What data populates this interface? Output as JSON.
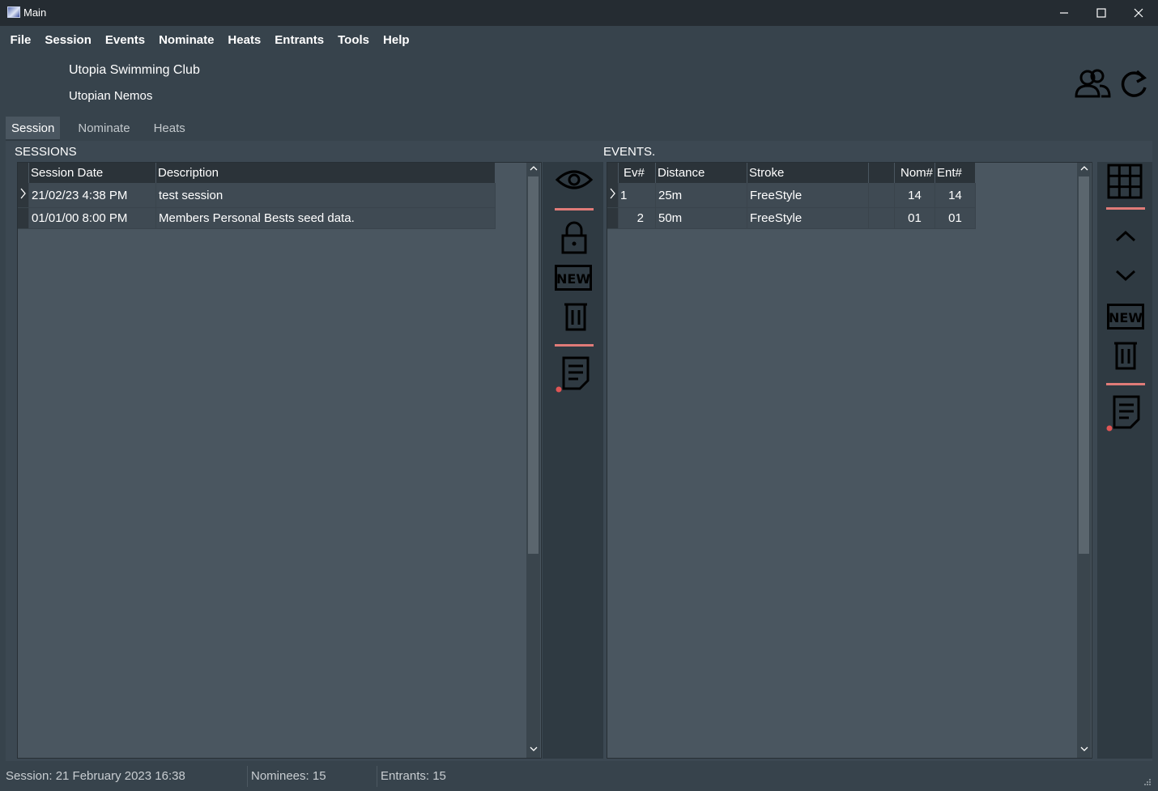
{
  "window": {
    "title": "Main"
  },
  "menu": [
    "File",
    "Session",
    "Events",
    "Nominate",
    "Heats",
    "Entrants",
    "Tools",
    "Help"
  ],
  "header": {
    "club": "Utopia Swimming Club",
    "team": "Utopian Nemos"
  },
  "tabs": [
    "Session",
    "Nominate",
    "Heats"
  ],
  "sessions": {
    "label": "SESSIONS",
    "columns": [
      "Session Date",
      "Description"
    ],
    "rows": [
      {
        "date": "21/02/23 4:38 PM",
        "description": "test session"
      },
      {
        "date": "01/01/00 8:00 PM",
        "description": "Members Personal Bests seed data."
      }
    ]
  },
  "events": {
    "label": "EVENTS.",
    "columns": [
      "Ev#",
      "Distance",
      "Stroke",
      "",
      "Nom#",
      "Ent#"
    ],
    "rows": [
      {
        "ev": "1",
        "distance": "25m",
        "stroke": "FreeStyle",
        "blank": "",
        "nom": "14",
        "ent": "14"
      },
      {
        "ev": "2",
        "distance": "50m",
        "stroke": "FreeStyle",
        "blank": "",
        "nom": "01",
        "ent": "01"
      }
    ]
  },
  "icons": {
    "middle_toolbar": [
      "eye-icon",
      "lock-icon",
      "new-icon",
      "trash-icon",
      "report-icon"
    ],
    "right_toolbar": [
      "grid-icon",
      "chevron-up-icon",
      "chevron-down-icon",
      "new-icon",
      "trash-icon",
      "report-icon"
    ],
    "top": [
      "members-icon",
      "refresh-icon"
    ],
    "new_text": "NEW"
  },
  "status": {
    "session": "Session: 21 February 2023 16:38",
    "nominees": "Nominees: 15",
    "entrants": "Entrants: 15"
  },
  "colors": {
    "separator": "#e07b78",
    "background": "#37434c",
    "grid": "#4a5660"
  }
}
